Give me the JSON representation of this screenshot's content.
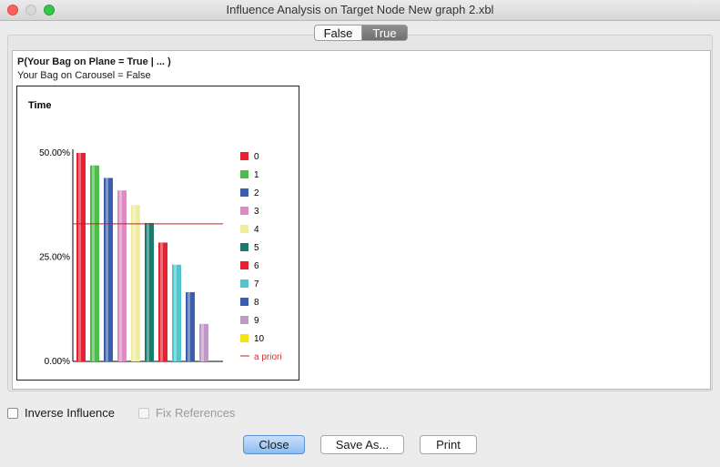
{
  "window": {
    "title": "Influence Analysis on Target Node New graph 2.xbl"
  },
  "state_tabs": [
    {
      "label": "False",
      "selected": false
    },
    {
      "label": "True",
      "selected": true
    }
  ],
  "query": {
    "title": "P(Your Bag on Plane = True | ... )",
    "evidence": "Your Bag on Carousel = False"
  },
  "chart_data": {
    "type": "bar",
    "title": "Time",
    "categories": [
      "0",
      "1",
      "2",
      "3",
      "4",
      "5",
      "6",
      "7",
      "8",
      "9",
      "10"
    ],
    "values": [
      50.0,
      47.0,
      44.0,
      41.0,
      37.5,
      33.2,
      28.5,
      23.2,
      16.6,
      9.0,
      0
    ],
    "colors": [
      "#e8202f",
      "#4fbb4c",
      "#3a5fae",
      "#dc8cc1",
      "#f1ed9f",
      "#1a7a6e",
      "#e8202f",
      "#52c4cc",
      "#3a5fae",
      "#c09ac7",
      "#f4e416"
    ],
    "ylim": [
      0,
      50
    ],
    "yticks": [
      "50.00%",
      "25.00%",
      "0.00%"
    ],
    "ytick_values": [
      50,
      25,
      0
    ],
    "apriori": 33.0,
    "apriori_label": "a priori",
    "apriori_color": "#c81e1e",
    "legend_position": "right"
  },
  "options": {
    "inverse_influence": "Inverse Influence",
    "fix_references": "Fix References"
  },
  "buttons": {
    "close": "Close",
    "save_as": "Save As...",
    "print": "Print"
  }
}
